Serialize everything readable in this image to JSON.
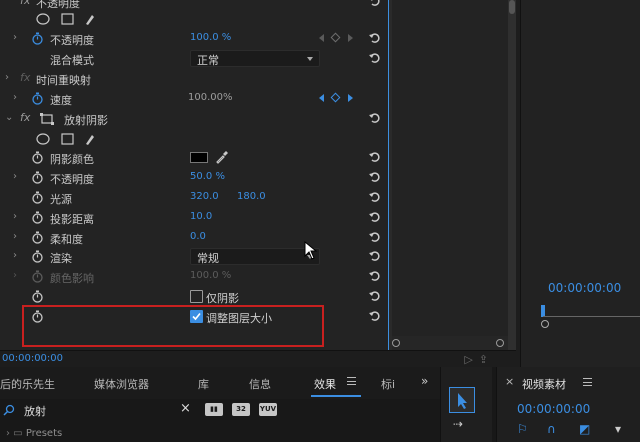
{
  "effect_controls": {
    "opacity_section": {
      "label": "不透明度"
    },
    "opacity": {
      "label": "不透明度",
      "value": "100.0 %"
    },
    "blend_mode": {
      "label": "混合模式",
      "value": "正常"
    },
    "time_remap_section": {
      "label": "时间重映射"
    },
    "speed": {
      "label": "速度",
      "value": "100.00%"
    },
    "drop_shadow_section": {
      "label": "放射阴影"
    },
    "shadow_color": {
      "label": "阴影颜色"
    },
    "shadow_opacity": {
      "label": "不透明度",
      "value": "50.0 %"
    },
    "light_source": {
      "label": "光源",
      "value_x": "320.0",
      "value_y": "180.0"
    },
    "distance": {
      "label": "投影距离",
      "value": "10.0"
    },
    "softness": {
      "label": "柔和度",
      "value": "0.0"
    },
    "render": {
      "label": "渲染",
      "value": "常规"
    },
    "color_influence": {
      "label": "颜色影响",
      "value": "100.0 %"
    },
    "shadow_only": {
      "label": "仅阴影",
      "checked": false
    },
    "resize_layer": {
      "label": "调整图层大小",
      "checked": true
    },
    "current_time": "00:00:00:00"
  },
  "program_monitor": {
    "timecode": "00:00:00:00"
  },
  "bottom_panel": {
    "tabs": [
      {
        "label": "后的乐先生"
      },
      {
        "label": "媒体浏览器"
      },
      {
        "label": "库"
      },
      {
        "label": "信息"
      },
      {
        "label": "效果",
        "active": true
      },
      {
        "label": "标i"
      }
    ],
    "more": "»",
    "search": {
      "value": "放射",
      "clear": "×"
    },
    "filter_buttons": [
      "32",
      "YUV"
    ],
    "presets_label": "Presets"
  },
  "source_panel": {
    "close": "×",
    "title": "视频素材",
    "timecode": "00:00:00:00"
  },
  "colors": {
    "accent": "#3b8ee2",
    "highlight_box": "#c8201f",
    "panel_bg": "#232323"
  }
}
